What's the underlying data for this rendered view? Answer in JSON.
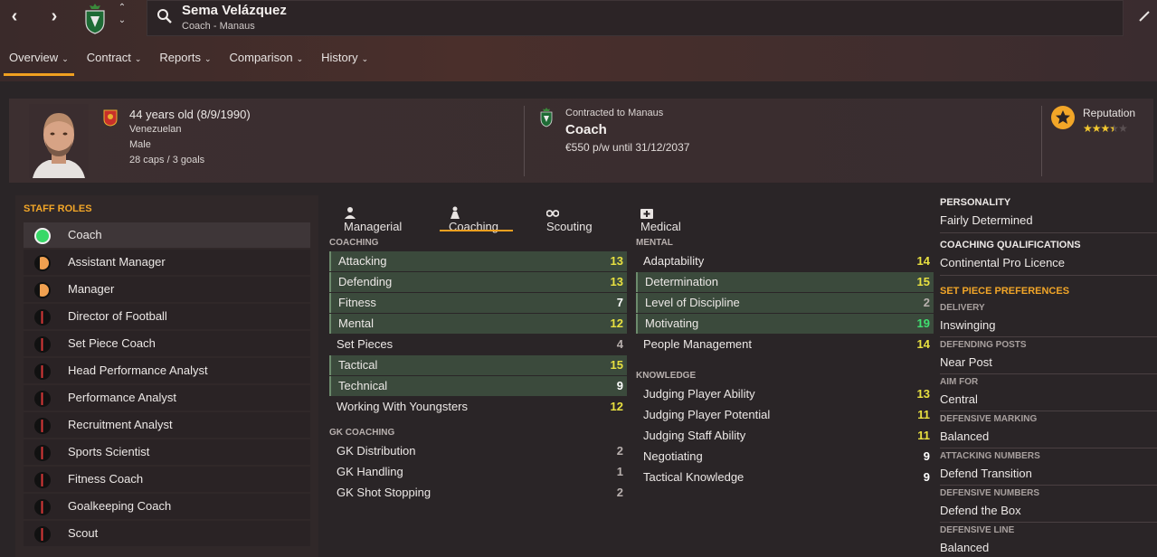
{
  "person": {
    "name": "Sema Velázquez",
    "subtitle": "Coach - Manaus"
  },
  "nav": {
    "tabs": [
      {
        "label": "Overview",
        "active": true
      },
      {
        "label": "Contract",
        "active": false
      },
      {
        "label": "Reports",
        "active": false
      },
      {
        "label": "Comparison",
        "active": false
      },
      {
        "label": "History",
        "active": false
      }
    ]
  },
  "profile": {
    "age": "44 years old (8/9/1990)",
    "nationality": "Venezuelan",
    "gender": "Male",
    "caps": "28 caps / 3 goals"
  },
  "contract": {
    "to": "Contracted to Manaus",
    "role": "Coach",
    "wage": "€550 p/w until 31/12/2037"
  },
  "reputation": {
    "label": "Reputation",
    "stars": 3.5,
    "max": 5
  },
  "staff_roles": {
    "title": "STAFF ROLES",
    "items": [
      {
        "label": "Coach",
        "suitability": "full",
        "active": true
      },
      {
        "label": "Assistant Manager",
        "suitability": "half",
        "active": false
      },
      {
        "label": "Manager",
        "suitability": "half",
        "active": false
      },
      {
        "label": "Director of Football",
        "suitability": "low",
        "active": false
      },
      {
        "label": "Set Piece Coach",
        "suitability": "low",
        "active": false
      },
      {
        "label": "Head Performance Analyst",
        "suitability": "low",
        "active": false
      },
      {
        "label": "Performance Analyst",
        "suitability": "low",
        "active": false
      },
      {
        "label": "Recruitment Analyst",
        "suitability": "low",
        "active": false
      },
      {
        "label": "Sports Scientist",
        "suitability": "low",
        "active": false
      },
      {
        "label": "Fitness Coach",
        "suitability": "low",
        "active": false
      },
      {
        "label": "Goalkeeping Coach",
        "suitability": "low",
        "active": false
      },
      {
        "label": "Scout",
        "suitability": "low",
        "active": false
      }
    ]
  },
  "subtabs": [
    {
      "label": "Managerial",
      "icon": "managerial-icon",
      "active": false
    },
    {
      "label": "Coaching",
      "icon": "coaching-icon",
      "active": true
    },
    {
      "label": "Scouting",
      "icon": "binoculars-icon",
      "active": false
    },
    {
      "label": "Medical",
      "icon": "medical-kit-icon",
      "active": false
    }
  ],
  "coaching": {
    "title": "COACHING",
    "items": [
      {
        "label": "Attacking",
        "value": 13,
        "hl": true
      },
      {
        "label": "Defending",
        "value": 13,
        "hl": true
      },
      {
        "label": "Fitness",
        "value": 7,
        "hl": true
      },
      {
        "label": "Mental",
        "value": 12,
        "hl": true
      },
      {
        "label": "Set Pieces",
        "value": 4,
        "hl": false
      },
      {
        "label": "Tactical",
        "value": 15,
        "hl": true
      },
      {
        "label": "Technical",
        "value": 9,
        "hl": true
      },
      {
        "label": "Working With Youngsters",
        "value": 12,
        "hl": false
      }
    ]
  },
  "gk_coaching": {
    "title": "GK COACHING",
    "items": [
      {
        "label": "GK Distribution",
        "value": 2,
        "hl": false
      },
      {
        "label": "GK Handling",
        "value": 1,
        "hl": false
      },
      {
        "label": "GK Shot Stopping",
        "value": 2,
        "hl": false
      }
    ]
  },
  "mental": {
    "title": "MENTAL",
    "items": [
      {
        "label": "Adaptability",
        "value": 14,
        "hl": false
      },
      {
        "label": "Determination",
        "value": 15,
        "hl": true
      },
      {
        "label": "Level of Discipline",
        "value": 2,
        "hl": true
      },
      {
        "label": "Motivating",
        "value": 19,
        "hl": true
      },
      {
        "label": "People Management",
        "value": 14,
        "hl": false
      }
    ]
  },
  "knowledge": {
    "title": "KNOWLEDGE",
    "items": [
      {
        "label": "Judging Player Ability",
        "value": 13,
        "hl": false
      },
      {
        "label": "Judging Player Potential",
        "value": 11,
        "hl": false
      },
      {
        "label": "Judging Staff Ability",
        "value": 11,
        "hl": false
      },
      {
        "label": "Negotiating",
        "value": 9,
        "hl": false
      },
      {
        "label": "Tactical Knowledge",
        "value": 9,
        "hl": false
      }
    ]
  },
  "side": {
    "personality_title": "PERSONALITY",
    "personality": "Fairly Determined",
    "qual_title": "COACHING QUALIFICATIONS",
    "qual": "Continental Pro Licence",
    "setpiece_title": "SET PIECE PREFERENCES",
    "prefs": [
      {
        "label": "DELIVERY",
        "value": "Inswinging"
      },
      {
        "label": "DEFENDING POSTS",
        "value": "Near Post"
      },
      {
        "label": "AIM FOR",
        "value": "Central"
      },
      {
        "label": "DEFENSIVE MARKING",
        "value": "Balanced"
      },
      {
        "label": "ATTACKING NUMBERS",
        "value": "Defend Transition"
      },
      {
        "label": "DEFENSIVE NUMBERS",
        "value": "Defend the Box"
      },
      {
        "label": "DEFENSIVE LINE",
        "value": "Balanced"
      }
    ]
  },
  "colors": {
    "accent": "#f2a628",
    "val_low": "#b8b0ae",
    "val_mid": "#ffffff",
    "val_good": "#e8e040",
    "val_great": "#40e070"
  }
}
